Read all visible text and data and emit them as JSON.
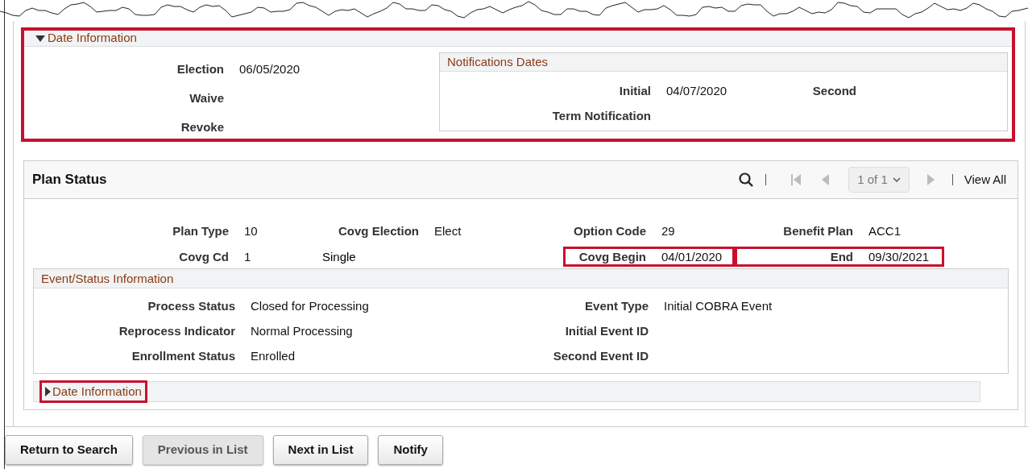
{
  "date_information": {
    "title": "Date Information",
    "expanded": true,
    "highlighted": true,
    "fields": [
      {
        "label": "Election",
        "value": "06/05/2020"
      },
      {
        "label": "Waive"
      },
      {
        "label": "Revoke"
      }
    ],
    "notifications": {
      "title": "Notifications Dates",
      "rows": [
        [
          {
            "label": "Initial",
            "value": "04/07/2020"
          },
          {
            "label": "Second"
          }
        ],
        [
          {
            "label": "Term Notification"
          }
        ]
      ]
    }
  },
  "plan_status": {
    "title": "Plan Status",
    "pager": {
      "page": "1 of 1",
      "view_all": "View All",
      "first_disabled": true,
      "prev_disabled": true,
      "next_disabled": true
    },
    "rows": [
      [
        {
          "label": "Plan Type",
          "value": "10"
        },
        {
          "label": "Covg Election",
          "value": "Elect"
        },
        {
          "label": "Option Code",
          "value": "29"
        },
        {
          "label": "Benefit Plan",
          "value": "ACC1"
        }
      ],
      [
        {
          "label": "Covg Cd",
          "value": "1"
        },
        {
          "value": "Single"
        },
        {
          "label": "Covg Begin",
          "value": "04/01/2020",
          "highlighted": true
        },
        {
          "label": "End",
          "value": "09/30/2021",
          "highlighted": true
        }
      ]
    ],
    "event_status": {
      "title": "Event/Status Information",
      "rows": [
        [
          {
            "label": "Process Status",
            "value": "Closed for Processing"
          },
          {
            "label": "Event Type",
            "value": "Initial COBRA Event"
          }
        ],
        [
          {
            "label": "Reprocess Indicator",
            "value": "Normal Processing"
          },
          {
            "label": "Initial Event ID"
          }
        ],
        [
          {
            "label": "Enrollment Status",
            "value": "Enrolled"
          },
          {
            "label": "Second Event ID"
          }
        ]
      ]
    },
    "date_information": {
      "title": "Date Information",
      "expanded": false,
      "highlighted": true
    }
  },
  "buttons": [
    {
      "label": "Return to Search",
      "disabled": false
    },
    {
      "label": "Previous in List",
      "disabled": true
    },
    {
      "label": "Next in List",
      "disabled": false
    },
    {
      "label": "Notify",
      "disabled": false
    }
  ]
}
